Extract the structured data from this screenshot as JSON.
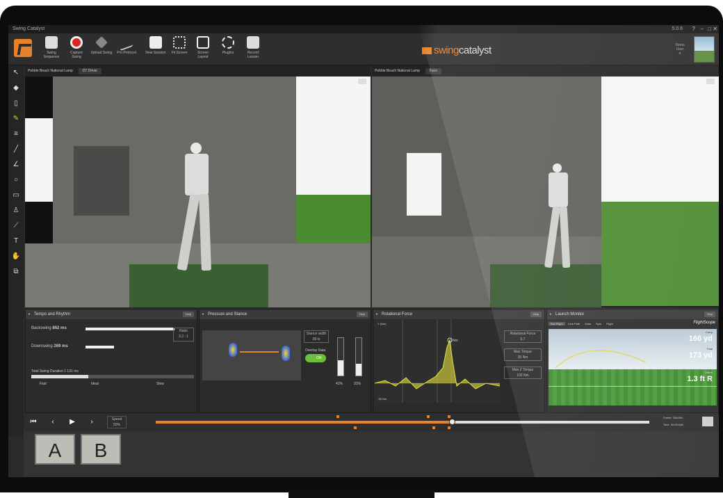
{
  "app": {
    "title": "Swing Catalyst",
    "version": "5.0.6"
  },
  "toolbar": {
    "items": [
      "Swing Sequence",
      "Capture Swing",
      "Upload Swing",
      "Pro Protocol",
      "New Session",
      "Fit Screen",
      "Screen Layout",
      "Plugins",
      "Record Lesson"
    ],
    "brand_prefix": "swing",
    "brand_suffix": "catalyst",
    "demo_label": "Demo User"
  },
  "video_left": {
    "label": "Pebble Beach National Lamp",
    "tag": "DT Driver"
  },
  "video_right": {
    "label": "Pebble Beach National Lamp",
    "tag": "Face"
  },
  "tempo": {
    "title": "Tempo and Rhythm",
    "help": "Help",
    "backswing_label": "Backswing",
    "backswing_value": "862 ms",
    "downswing_label": "Downswing",
    "downswing_value": "269 ms",
    "ratio_label": "Ratio",
    "ratio_value": "3.2 : 1",
    "total_label": "Total Swing Duration",
    "total_value": "1 131 ms",
    "scale": [
      "Fast",
      "Ideal",
      "Slow"
    ],
    "backswing_fraction": 0.85,
    "downswing_fraction": 0.27
  },
  "pressure": {
    "title": "Pressure and Stance",
    "help": "Help",
    "stance_label": "Stance width",
    "stance_value": "28 in",
    "overlay_label": "Overlay Data",
    "toggle": "ON",
    "left_pct": "41%",
    "right_pct": "31%",
    "left_fill": 0.41,
    "right_fill": 0.31
  },
  "rotational": {
    "title": "Rotational Force",
    "help": "Help",
    "peak_label": "Nm",
    "axis_top": "Y (Nm)",
    "axis_bottom": "-38 Nm",
    "stats": [
      {
        "label": "Rotational Force",
        "value": "5.7"
      },
      {
        "label": "Max Torque",
        "value": "35 Nm"
      },
      {
        "label": "Max Z Torque",
        "value": "103 Nm"
      }
    ]
  },
  "launch": {
    "title": "Launch Monitor",
    "help": "Help",
    "tabs": [
      "Ball Flight",
      "Club Path",
      "Data",
      "Spin",
      "Flight"
    ],
    "brand": "FlightScope",
    "carry_label": "Carry",
    "carry_value": "166 yd",
    "total_label": "Total",
    "total_value": "173 yd",
    "offline_label": "Offline",
    "offline_value": "1.3 ft R"
  },
  "transport": {
    "speed_label": "Speed",
    "speed_value": "50%",
    "frame_label": "Frame",
    "frame_value": "258/300",
    "time_label": "Time",
    "time_value": "00:00:845",
    "progress": 0.6
  },
  "footer": {
    "a": "A",
    "b": "B"
  }
}
